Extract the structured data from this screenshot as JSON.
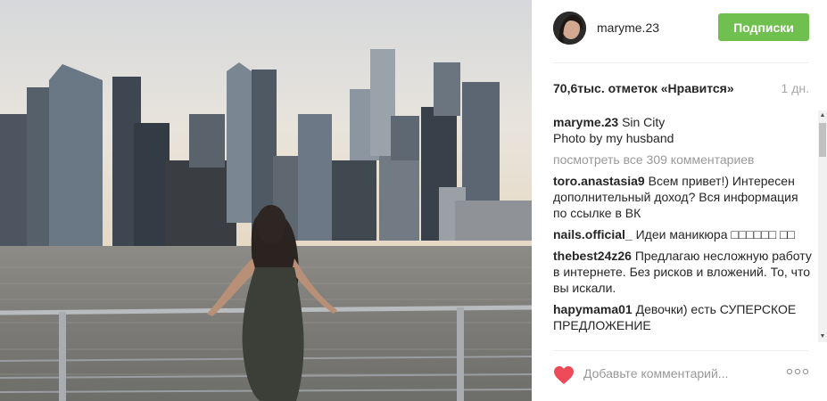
{
  "post": {
    "username": "maryme.23",
    "follow_label": "Подписки",
    "likes": "70,6тыс. отметок «Нравится»",
    "time": "1 дн.",
    "caption_user": "maryme.23",
    "caption_line1": "Sin City",
    "caption_line2": "Photo by my husband",
    "view_all": "посмотреть все 309 комментариев"
  },
  "comments": [
    {
      "user": "toro.anastasia9",
      "text": "Всем привет!) Интересен дополнительный доход? Вся информация по ссылке в ВК"
    },
    {
      "user": "nails.official_",
      "text": "Идеи маникюра □□□□□□ □□"
    },
    {
      "user": "thebest24z26",
      "text": "Предлагаю несложную работу в интернете. Без рисков и вложений. То, что вы искали."
    },
    {
      "user": "hapymama01",
      "text": "Девочки) есть СУПЕРСКОЕ ПРЕДЛОЖЕНИЕ"
    }
  ],
  "comment_box": {
    "placeholder": "Добавьте комментарий..."
  },
  "icons": {
    "like": "heart-icon",
    "more": "more-options-icon",
    "scroll_up": "scroll-up-arrow",
    "scroll_down": "scroll-down-arrow"
  },
  "colors": {
    "follow_button": "#70c050",
    "heart": "#ed4956",
    "muted_text": "#999999"
  }
}
